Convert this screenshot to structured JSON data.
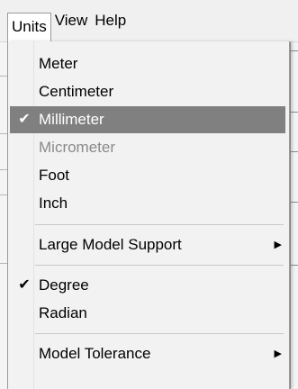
{
  "menubar": {
    "items": [
      {
        "label": "Units"
      },
      {
        "label": "View"
      },
      {
        "label": "Help"
      }
    ]
  },
  "units_menu": {
    "items": [
      {
        "label": "Meter",
        "checked": false,
        "disabled": false
      },
      {
        "label": "Centimeter",
        "checked": false,
        "disabled": false
      },
      {
        "label": "Millimeter",
        "checked": true,
        "disabled": false,
        "highlighted": true
      },
      {
        "label": "Micrometer",
        "checked": false,
        "disabled": true
      },
      {
        "label": "Foot",
        "checked": false,
        "disabled": false
      },
      {
        "label": "Inch",
        "checked": false,
        "disabled": false
      },
      {
        "label": "Large Model Support",
        "submenu": true
      },
      {
        "label": "Degree",
        "checked": true,
        "disabled": false
      },
      {
        "label": "Radian",
        "checked": false,
        "disabled": false
      },
      {
        "label": "Model Tolerance",
        "submenu": true
      }
    ],
    "check_glyph": "✔",
    "submenu_glyph": "▶"
  },
  "colors": {
    "highlight": "#808080",
    "disabled_text": "#8a8a8a",
    "menu_background": "#f2f2f2"
  }
}
